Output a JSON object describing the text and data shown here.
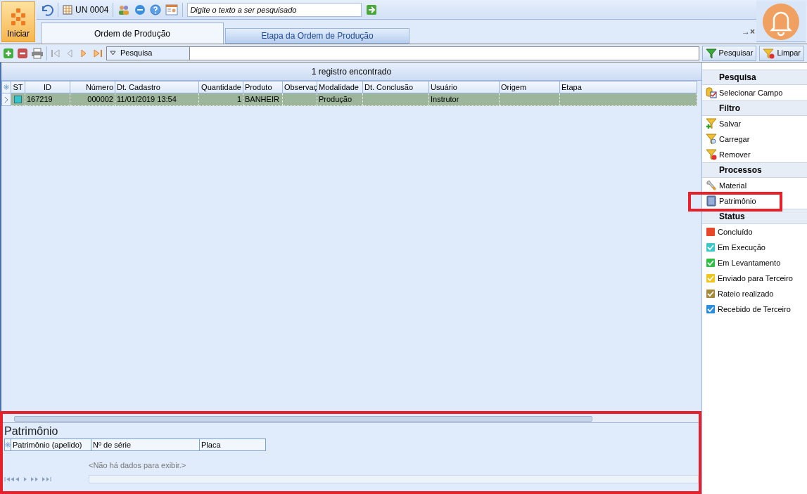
{
  "start_button": {
    "label": "Iniciar"
  },
  "unit": {
    "label": "UN 0004"
  },
  "global_search": {
    "placeholder": "Digite o texto a ser pesquisado"
  },
  "tabs": [
    {
      "label": "Ordem de Produção",
      "selected": true
    },
    {
      "label": "Etapa da Ordem de Produção",
      "selected": false
    }
  ],
  "tab_controls": {
    "pin": "→",
    "close": "×"
  },
  "toolbar": {
    "filter_dropdown": "Pesquisa",
    "search_button": "Pesquisar",
    "clear_button": "Limpar"
  },
  "grid": {
    "summary": "1 registro encontrado",
    "columns": [
      "ST",
      "ID",
      "Número",
      "Dt. Cadastro",
      "Quantidade",
      "Produto",
      "Observaç",
      "Modalidade",
      "Dt. Conclusão",
      "Usuário",
      "Origem",
      "Etapa"
    ],
    "rows": [
      {
        "selected": true,
        "color": "#35c4c9",
        "cells": [
          "",
          "167219",
          "000002",
          "11/01/2019 13:54",
          "1",
          "BANHEIR",
          "",
          "Produção",
          "",
          "Instrutor",
          "",
          ""
        ]
      }
    ]
  },
  "sidebar": {
    "sections": [
      {
        "title": "Pesquisa",
        "items": [
          {
            "kind": "field",
            "label": "Selecionar Campo"
          }
        ]
      },
      {
        "title": "Filtro",
        "items": [
          {
            "kind": "filter-add",
            "label": "Salvar"
          },
          {
            "kind": "filter-load",
            "label": "Carregar"
          },
          {
            "kind": "filter-remove",
            "label": "Remover"
          }
        ]
      },
      {
        "title": "Processos",
        "items": [
          {
            "kind": "wrench",
            "label": "Material"
          },
          {
            "kind": "book",
            "label": "Patrimônio"
          }
        ]
      },
      {
        "title": "Status",
        "items": [
          {
            "kind": "status",
            "label": "Concluído",
            "color": "#e8472a",
            "checked": false
          },
          {
            "kind": "status",
            "label": "Em Execução",
            "color": "#3cc7c9",
            "checked": true
          },
          {
            "kind": "status",
            "label": "Em Levantamento",
            "color": "#2fbf45",
            "checked": true
          },
          {
            "kind": "status",
            "label": "Enviado para Terceiro",
            "color": "#f0c419",
            "checked": true
          },
          {
            "kind": "status",
            "label": "Rateio realizado",
            "color": "#a58a3a",
            "checked": true
          },
          {
            "kind": "status",
            "label": "Recebido de Terceiro",
            "color": "#2a8de0",
            "checked": true
          }
        ]
      }
    ]
  },
  "detail": {
    "title": "Patrimônio",
    "columns": [
      "Patrimônio (apelido)",
      "Nº de série",
      "Placa"
    ],
    "empty_text": "<Não há dados para exibir.>"
  }
}
